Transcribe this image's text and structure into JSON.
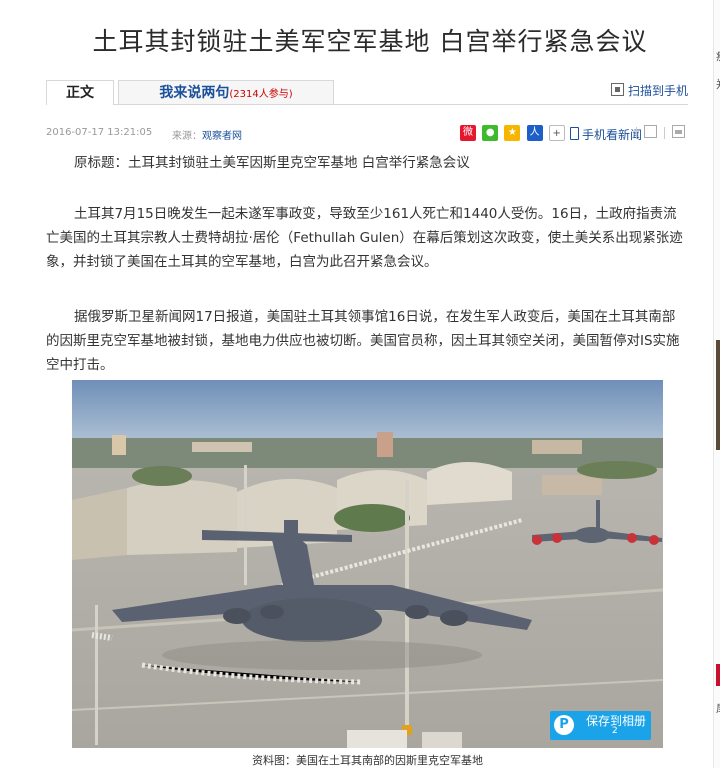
{
  "article": {
    "headline": "土耳其封锁驻土美军空军基地 白宫举行紧急会议",
    "tabs": {
      "main": "正文",
      "comment": "我来说两句",
      "comment_count": "(2314人参与)"
    },
    "scan_label": "扫描到手机",
    "date": "2016-07-17 13:21:05",
    "source_prefix": "来源：",
    "source_name": "观察者网",
    "mobile_label": "手机看新闻",
    "paragraphs": [
      "原标题：土耳其封锁驻土美军因斯里克空军基地 白宫举行紧急会议",
      "土耳其7月15日晚发生一起未遂军事政变，导致至少161人死亡和1440人受伤。16日，土政府指责流亡美国的土耳其宗教人士费特胡拉·居伦（Fethullah Gulen）在幕后策划这次政变，使土美关系出现紧张迹象，并封锁了美国在土耳其的空军基地，白宫为此召开紧急会议。",
      "据俄罗斯卫星新闻网17日报道，美国驻土耳其领事馆16日说，在发生军人政变后，美国在土耳其南部的因斯里克空军基地被封锁，基地电力供应也被切断。美国官员称，因土耳其领空关闭，美国暂停对IS实施空中打击。"
    ],
    "photo": {
      "save_label": "保存到相册",
      "save_count": "2",
      "caption": "资料图：美国在土耳其南部的因斯里克空军基地"
    },
    "share_icons": [
      "weibo-icon",
      "wechat-icon",
      "qzone-star-icon",
      "renren-icon",
      "more-plus-icon"
    ]
  },
  "edge": {
    "top_char": "痴",
    "second_char": "郑",
    "bottom_char": "扉"
  },
  "colors": {
    "link": "#1a4f9a",
    "accent_red": "#c00000",
    "save_blue": "#1aa3e8"
  }
}
